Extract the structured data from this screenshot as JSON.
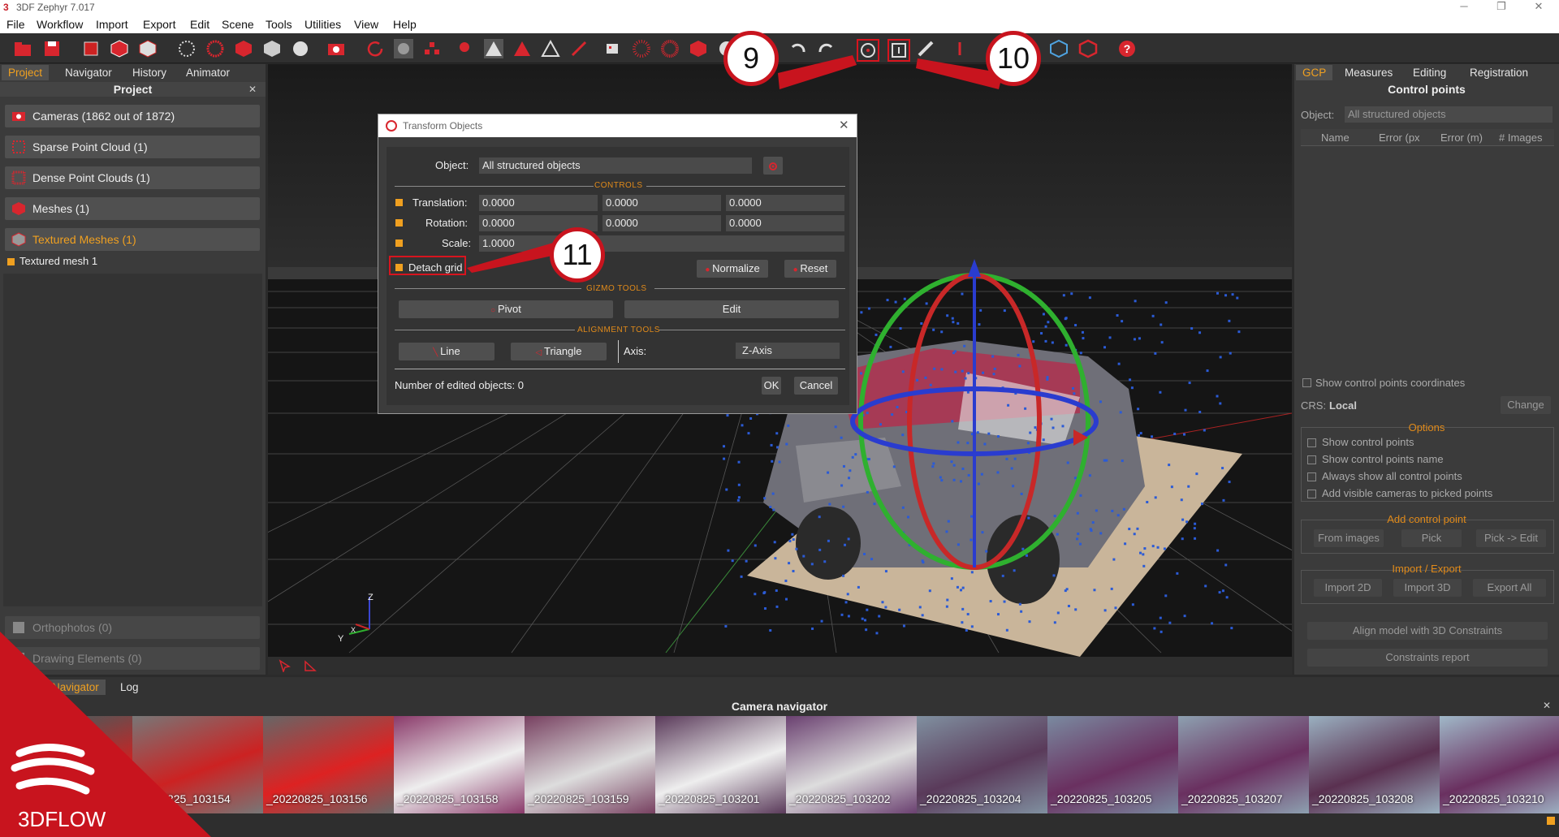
{
  "window": {
    "title": "3DF Zephyr 7.017",
    "logo_letter": "3"
  },
  "menu": [
    "File",
    "Workflow",
    "Import",
    "Export",
    "Edit",
    "Scene",
    "Tools",
    "Utilities",
    "View",
    "Help"
  ],
  "left_panel": {
    "tabs": [
      "Project",
      "Navigator",
      "History",
      "Animator"
    ],
    "header": "Project",
    "items": [
      {
        "label": "Cameras (1862 out of 1872)"
      },
      {
        "label": "Sparse Point Cloud (1)"
      },
      {
        "label": "Dense Point Clouds (1)"
      },
      {
        "label": "Meshes (1)"
      },
      {
        "label": "Textured Meshes (1)"
      }
    ],
    "sub_item": "Textured mesh 1",
    "bottom_items": [
      "Orthophotos (0)",
      "Drawing Elements (0)"
    ]
  },
  "dialog": {
    "title": "Transform Objects",
    "object_label": "Object:",
    "object_value": "All structured objects",
    "controls_label": "CONTROLS",
    "translation_label": "Translation:",
    "translation": [
      "0.0000",
      "0.0000",
      "0.0000"
    ],
    "rotation_label": "Rotation:",
    "rotation": [
      "0.0000",
      "0.0000",
      "0.0000"
    ],
    "scale_label": "Scale:",
    "scale": "1.0000",
    "detach_grid": "Detach grid",
    "normalize": "Normalize",
    "reset": "Reset",
    "gizmo_label": "GIZMO TOOLS",
    "pivot": "Pivot",
    "edit": "Edit",
    "alignment_label": "ALIGNMENT TOOLS",
    "line": "Line",
    "triangle": "Triangle",
    "axis_label": "Axis:",
    "axis_value": "Z-Axis",
    "edited_count": "Number of edited objects: 0",
    "ok": "OK",
    "cancel": "Cancel"
  },
  "callouts": [
    "9",
    "10",
    "11"
  ],
  "axes": {
    "z": "Z",
    "y": "Y",
    "x": "X"
  },
  "right_panel": {
    "tabs": [
      "GCP",
      "Measures",
      "Editing",
      "Registration"
    ],
    "header": "Control points",
    "object_label": "Object:",
    "object_value": "All structured objects",
    "columns": [
      "Name",
      "Error (px",
      "Error (m)",
      "# Images"
    ],
    "show_coords": "Show control points coordinates",
    "crs_label": "CRS:",
    "crs_value": "Local",
    "change": "Change",
    "options_label": "Options",
    "options": [
      "Show control points",
      "Show control points name",
      "Always show all control points",
      "Add visible cameras to picked points"
    ],
    "add_cp_label": "Add control point",
    "add_cp_buttons": [
      "From images",
      "Pick",
      "Pick -> Edit"
    ],
    "ie_label": "Import / Export",
    "ie_buttons": [
      "Import 2D",
      "Import 3D",
      "Export All"
    ],
    "align_btn": "Align model with 3D Constraints",
    "report_btn": "Constraints report"
  },
  "bottom": {
    "tabs": [
      "Navigator",
      "Log"
    ],
    "header": "Camera navigator",
    "thumbs": [
      "",
      "20220825_103154",
      "_20220825_103156",
      "_20220825_103158",
      "_20220825_103159",
      "_20220825_103201",
      "_20220825_103202",
      "_20220825_103204",
      "_20220825_103205",
      "_20220825_103207",
      "_20220825_103208",
      "_20220825_103210"
    ]
  },
  "watermark": "3DFLOW",
  "colors": {
    "accent": "#f0a020",
    "brand_red": "#c8141e"
  }
}
